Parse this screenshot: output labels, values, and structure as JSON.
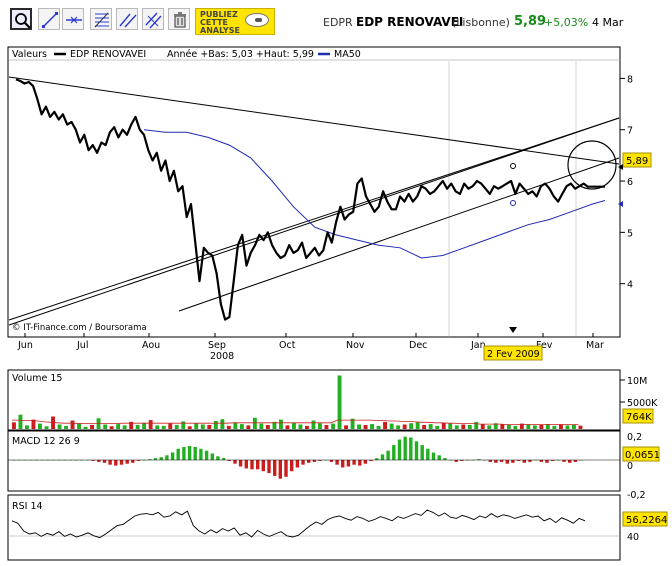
{
  "toolbar": {
    "tools": [
      "zoom-tool-icon",
      "line-tool-icon",
      "horizontal-line-tool-icon",
      "fibonacci-tool-icon",
      "channel-tool-icon",
      "parallel-lines-tool-icon",
      "trash-icon"
    ],
    "publish_label_1": "PUBLIEZ",
    "publish_label_2": "CETTE",
    "publish_label_3": "ANALYSE"
  },
  "quote": {
    "ticker": "EDPR",
    "name": "EDP RENOVAVEI",
    "market": "(Lisbonne)",
    "price": "5,89",
    "change": "+5,03%",
    "date": "4 Mar"
  },
  "colors": {
    "price": "#000000",
    "ma": "#1f2ab5",
    "up": "#22b022",
    "down": "#cc1d1d",
    "green_text": "#1a8a1a",
    "label_bg": "#ffe400"
  },
  "chart_data": [
    {
      "type": "line",
      "legend": {
        "valeurs": "Valeurs",
        "series_name": "EDP RENOVAVEI",
        "stats": "Année +Bas: 5,03 +Haut: 5,99",
        "ma_name": "MA50"
      },
      "x_ticks": [
        "Jun",
        "Jul",
        "Aou",
        "Sep",
        "Oct",
        "Nov",
        "Dec",
        "Jan",
        "Fev",
        "Mar"
      ],
      "year_label": "2008",
      "y_ticks": [
        "8",
        "7",
        "6",
        "5",
        "4"
      ],
      "ylim": [
        3,
        8.3
      ],
      "last_value_label": "5,89",
      "cursor_label": "2 Fev 2009",
      "credit": "© IT-Finance.com / Boursorama",
      "series": [
        {
          "name": "EDP RENOVAVEI",
          "color": "#000000",
          "x": [
            0,
            2,
            4,
            6,
            8,
            10,
            12,
            14,
            16,
            18,
            20,
            22,
            24,
            26,
            28,
            30,
            32,
            34,
            36,
            38,
            40,
            42,
            44,
            46,
            48,
            50,
            52,
            54,
            56,
            58,
            60,
            62,
            64,
            66,
            68,
            70,
            72,
            74,
            76,
            78,
            80,
            82,
            84,
            86,
            88,
            90,
            92,
            94,
            96,
            98,
            100,
            102,
            104,
            106,
            108,
            110,
            112,
            114,
            116,
            118,
            120,
            122,
            124,
            126,
            128,
            130,
            132,
            134,
            136,
            138,
            140,
            142,
            144,
            146,
            148,
            150,
            152,
            154,
            156,
            158,
            160,
            162,
            164,
            166,
            168,
            170,
            172,
            174,
            176,
            178,
            180,
            182,
            184,
            186,
            188,
            190,
            192,
            194,
            196,
            198,
            200,
            202,
            204,
            206,
            208,
            210,
            212,
            214,
            216,
            218,
            220,
            222,
            224,
            226,
            228,
            230,
            232,
            234,
            236,
            238,
            240,
            242,
            244,
            246,
            248,
            250,
            252,
            254,
            256,
            258,
            260,
            262,
            264,
            266,
            268,
            270,
            272,
            274,
            276
          ],
          "y": [
            7.98,
            7.95,
            7.9,
            7.93,
            7.85,
            7.6,
            7.3,
            7.45,
            7.25,
            7.35,
            7.2,
            7.3,
            7.1,
            7.15,
            7.0,
            6.75,
            6.9,
            6.6,
            6.7,
            6.55,
            6.75,
            6.7,
            6.95,
            7.05,
            6.85,
            7.0,
            6.9,
            7.1,
            7.25,
            7.0,
            6.9,
            6.6,
            6.4,
            6.55,
            6.2,
            6.4,
            6.0,
            6.2,
            5.8,
            5.9,
            5.3,
            5.55,
            4.8,
            4.05,
            4.7,
            4.6,
            4.55,
            4.2,
            3.6,
            3.3,
            3.35,
            4.05,
            4.75,
            4.95,
            4.35,
            4.6,
            4.75,
            4.95,
            4.85,
            5.0,
            4.75,
            4.6,
            4.5,
            4.55,
            4.75,
            4.6,
            4.65,
            4.8,
            4.5,
            4.6,
            4.7,
            4.55,
            4.65,
            5.0,
            4.8,
            5.2,
            5.5,
            5.25,
            5.35,
            5.4,
            5.95,
            6.05,
            5.7,
            5.55,
            5.4,
            5.5,
            5.8,
            5.6,
            5.45,
            5.45,
            5.7,
            5.6,
            5.75,
            5.6,
            5.7,
            5.9,
            5.85,
            5.75,
            5.8,
            5.9,
            6.0,
            5.85,
            5.95,
            5.8,
            5.75,
            5.95,
            5.85,
            5.9,
            6.0,
            5.95,
            5.85,
            5.75,
            5.9,
            5.85,
            5.9,
            5.95,
            6.0,
            5.75,
            5.95,
            5.85,
            5.75,
            5.8,
            5.7,
            5.9,
            5.95,
            5.85,
            5.7,
            5.6,
            5.75,
            5.9,
            5.95,
            5.85,
            5.9,
            5.95,
            5.89,
            5.89,
            5.89,
            5.89,
            5.89
          ]
        },
        {
          "name": "MA50",
          "color": "#1f2ab5",
          "x": [
            60,
            70,
            80,
            90,
            100,
            110,
            120,
            130,
            140,
            150,
            160,
            170,
            180,
            190,
            200,
            210,
            220,
            230,
            240,
            250,
            260,
            270,
            276
          ],
          "y": [
            7.0,
            6.95,
            6.95,
            6.85,
            6.7,
            6.45,
            6.0,
            5.5,
            5.1,
            4.95,
            4.85,
            4.75,
            4.7,
            4.5,
            4.55,
            4.7,
            4.85,
            5.0,
            5.15,
            5.25,
            5.4,
            5.55,
            5.62
          ]
        }
      ]
    },
    {
      "type": "bar",
      "label": "Volume 15",
      "y_ticks": [
        "10M",
        "5000K"
      ],
      "last_value_label": "764K",
      "values": [
        1.5,
        3.2,
        0.8,
        2.1,
        1.2,
        0.6,
        2.8,
        1.0,
        0.7,
        1.9,
        1.3,
        0.5,
        0.9,
        2.4,
        1.0,
        0.6,
        1.1,
        0.8,
        1.6,
        0.9,
        1.4,
        2.0,
        0.8,
        0.7,
        1.2,
        0.9,
        1.7,
        0.6,
        1.3,
        1.0,
        0.9,
        1.8,
        2.2,
        0.7,
        1.5,
        1.1,
        0.8,
        2.5,
        1.2,
        0.9,
        1.6,
        2.1,
        0.8,
        1.4,
        1.0,
        0.7,
        1.9,
        1.3,
        0.9,
        1.2,
        12.0,
        0.8,
        2.3,
        1.0,
        0.9,
        1.1,
        0.7,
        1.6,
        1.2,
        0.8,
        1.0,
        1.3,
        1.5,
        0.9,
        1.1,
        0.7,
        1.4,
        1.2,
        0.8,
        1.0,
        0.9,
        1.6,
        1.1,
        0.8,
        1.3,
        1.0,
        0.9,
        0.7,
        1.2,
        1.0,
        0.8,
        0.9,
        1.1,
        0.7,
        1.0,
        0.8,
        0.9,
        0.76
      ],
      "ma_values": [
        2.0,
        2.0,
        1.9,
        1.9,
        1.8,
        1.6,
        1.5,
        1.4,
        1.3,
        1.3,
        1.2,
        1.2,
        1.2,
        1.2,
        1.2,
        1.2,
        1.2,
        1.3,
        1.3,
        1.3,
        1.3,
        1.3,
        1.3,
        1.3,
        1.3,
        1.3,
        1.3,
        1.3,
        1.3,
        1.3,
        1.3,
        1.3,
        1.3,
        1.3,
        1.4,
        1.4,
        1.4,
        1.4,
        1.4,
        1.4,
        1.4,
        1.4,
        1.4,
        1.4,
        1.4,
        1.4,
        1.4,
        1.4,
        1.4,
        1.4,
        2.0,
        2.0,
        2.0,
        2.0,
        2.0,
        2.0,
        1.9,
        1.9,
        1.8,
        1.8,
        1.7,
        1.7,
        1.6,
        1.5,
        1.5,
        1.4,
        1.4,
        1.3,
        1.3,
        1.2,
        1.2,
        1.2,
        1.1,
        1.1,
        1.1,
        1.1,
        1.0,
        1.0,
        1.0,
        1.0,
        1.0,
        1.0,
        1.0,
        1.0,
        1.0,
        1.0,
        1.0,
        1.0
      ]
    },
    {
      "type": "bar",
      "label": "MACD 12 26 9",
      "y_ticks": [
        "0,2",
        "0",
        "-0,2"
      ],
      "last_value_label": "0,0651",
      "values": [
        0,
        0,
        0,
        0,
        0,
        0,
        0,
        0,
        0,
        0,
        0,
        0,
        0,
        0,
        -0.01,
        -0.02,
        -0.03,
        -0.05,
        -0.06,
        -0.05,
        -0.04,
        -0.03,
        -0.01,
        0.0,
        0.01,
        0.02,
        0.03,
        0.05,
        0.08,
        0.12,
        0.14,
        0.15,
        0.14,
        0.12,
        0.1,
        0.07,
        0.04,
        0.02,
        -0.01,
        -0.04,
        -0.07,
        -0.09,
        -0.1,
        -0.1,
        -0.12,
        -0.14,
        -0.17,
        -0.2,
        -0.18,
        -0.12,
        -0.08,
        -0.05,
        -0.03,
        -0.02,
        -0.01,
        0.0,
        -0.02,
        -0.05,
        -0.08,
        -0.07,
        -0.05,
        -0.06,
        -0.04,
        -0.01,
        0.02,
        0.06,
        0.1,
        0.16,
        0.22,
        0.25,
        0.24,
        0.2,
        0.16,
        0.12,
        0.08,
        0.05,
        0.02,
        0.0,
        -0.02,
        -0.01,
        0.0,
        0.0,
        0.01,
        0.0,
        -0.02,
        -0.03,
        -0.02,
        -0.04,
        -0.03,
        -0.01,
        -0.03,
        -0.02,
        0.0,
        -0.02,
        -0.03,
        -0.01,
        0.0,
        -0.02,
        -0.03,
        -0.02,
        0.0
      ],
      "ylim": [
        -0.3,
        0.3
      ]
    },
    {
      "type": "line",
      "label": "RSI 14",
      "y_ticks": [
        "40"
      ],
      "last_value_label": "56,2264",
      "ylim": [
        0,
        100
      ],
      "values": [
        62,
        58,
        45,
        40,
        42,
        36,
        41,
        38,
        44,
        36,
        40,
        35,
        38,
        42,
        37,
        34,
        40,
        47,
        54,
        56,
        63,
        70,
        73,
        74,
        72,
        76,
        68,
        70,
        77,
        72,
        78,
        54,
        45,
        40,
        47,
        42,
        49,
        45,
        50,
        38,
        42,
        35,
        46,
        40,
        36,
        40,
        44,
        37,
        35,
        38,
        46,
        54,
        60,
        56,
        64,
        68,
        70,
        66,
        63,
        69,
        66,
        61,
        64,
        69,
        66,
        62,
        69,
        66,
        70,
        74,
        71,
        80,
        76,
        70,
        75,
        68,
        66,
        71,
        68,
        64,
        70,
        67,
        74,
        68,
        72,
        70,
        66,
        69,
        72,
        68,
        70,
        62,
        66,
        59,
        67,
        63,
        58,
        66,
        62
      ]
    }
  ]
}
